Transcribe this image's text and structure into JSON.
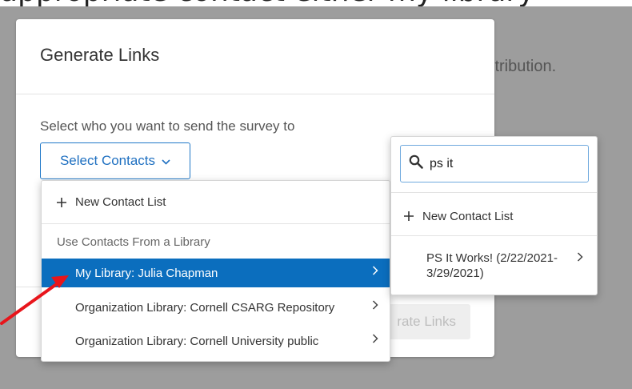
{
  "page_caption": "appropriate contact either my library",
  "background": {
    "partial_text": "istribution."
  },
  "modal": {
    "title": "Generate Links",
    "prompt": "Select who you want to send the survey to",
    "select_button_label": "Select Contacts",
    "generate_button_partial": "rate Links"
  },
  "dropdown": {
    "new_contact_list": "New Contact List",
    "section_header": "Use Contacts From a Library",
    "items": [
      {
        "label": "My Library: Julia Chapman",
        "selected": true
      },
      {
        "label": "Organization Library: Cornell CSARG Repository",
        "selected": false
      },
      {
        "label": "Organization Library: Cornell University public",
        "selected": false
      }
    ]
  },
  "submenu": {
    "search_value": "ps it",
    "new_contact_list": "New Contact List",
    "results": [
      {
        "label": "PS It Works! (2/22/2021- 3/29/2021)"
      }
    ]
  },
  "colors": {
    "accent": "#0b6ebe",
    "overlay": "#9d9d9d",
    "annotation_arrow": "#e8151b"
  },
  "icons": [
    "chevron-down-icon",
    "plus-icon",
    "chevron-right-icon",
    "search-icon",
    "annotation-arrow-icon"
  ]
}
